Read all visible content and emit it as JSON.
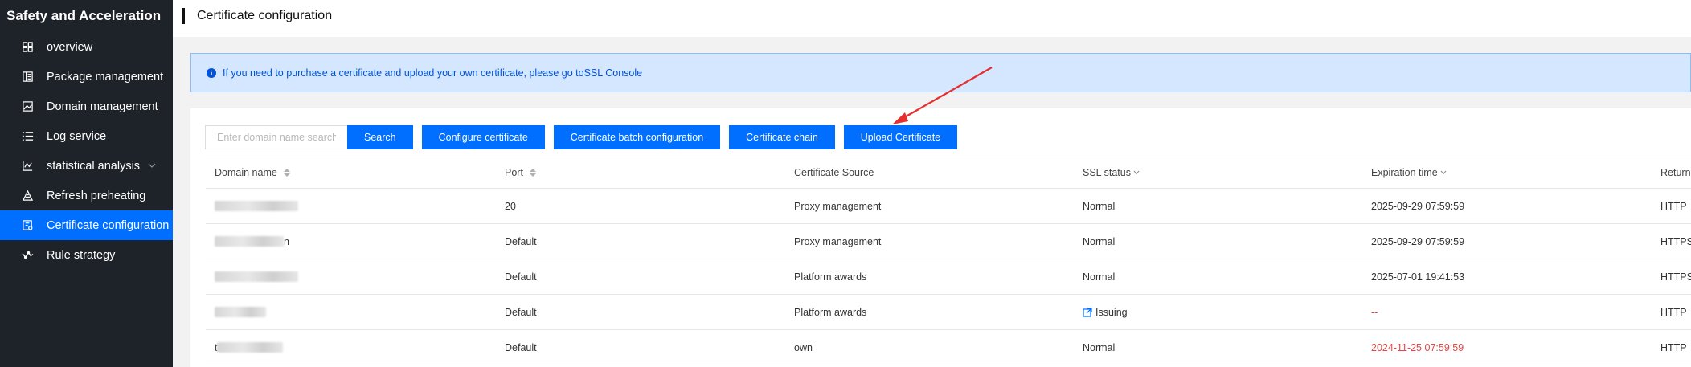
{
  "sidebar": {
    "title": "Safety and Acceleration",
    "items": [
      {
        "label": "overview",
        "icon": "grid-icon"
      },
      {
        "label": "Package management",
        "icon": "package-icon"
      },
      {
        "label": "Domain management",
        "icon": "domain-icon"
      },
      {
        "label": "Log service",
        "icon": "list-icon"
      },
      {
        "label": "statistical analysis",
        "icon": "chart-icon"
      },
      {
        "label": "Refresh preheating",
        "icon": "refresh-icon"
      },
      {
        "label": "Certificate configuration",
        "icon": "certificate-icon"
      },
      {
        "label": "Rule strategy",
        "icon": "rule-icon"
      }
    ],
    "active_index": 6
  },
  "header": {
    "title": "Certificate configuration"
  },
  "notice": {
    "text": "If you need to purchase a certificate and upload your own certificate, please go toSSL Console"
  },
  "toolbar": {
    "search_placeholder": "Enter domain name search",
    "search_label": "Search",
    "configure_label": "Configure certificate",
    "batch_label": "Certificate batch configuration",
    "chain_label": "Certificate chain",
    "upload_label": "Upload Certificate"
  },
  "table": {
    "columns": [
      "Domain name",
      "Port",
      "Certificate Source",
      "SSL status",
      "Expiration time",
      "Return type"
    ],
    "rows": [
      {
        "domain": "",
        "domain_suffix": "",
        "port": "20",
        "source": "Proxy management",
        "status": "Normal",
        "expiration": "2025-09-29 07:59:59",
        "return_type": "HTTP"
      },
      {
        "domain": "",
        "domain_suffix": "n",
        "port": "Default",
        "source": "Proxy management",
        "status": "Normal",
        "expiration": "2025-09-29 07:59:59",
        "return_type": "HTTPS"
      },
      {
        "domain": "",
        "domain_suffix": "",
        "port": "Default",
        "source": "Platform awards",
        "status": "Normal",
        "expiration": "2025-07-01 19:41:53",
        "return_type": "HTTPS"
      },
      {
        "domain": "",
        "domain_suffix": "",
        "port": "Default",
        "source": "Platform awards",
        "status": "Issuing",
        "expiration": "--",
        "return_type": "HTTP"
      },
      {
        "domain": "t",
        "domain_suffix": "",
        "port": "Default",
        "source": "own",
        "status": "Normal",
        "expiration": "2024-11-25 07:59:59",
        "return_type": "HTTP"
      }
    ]
  },
  "colors": {
    "accent": "#006eff",
    "sidebar_bg": "#1e2229",
    "expired": "#e54545",
    "annotation_arrow": "#e62e2e"
  }
}
